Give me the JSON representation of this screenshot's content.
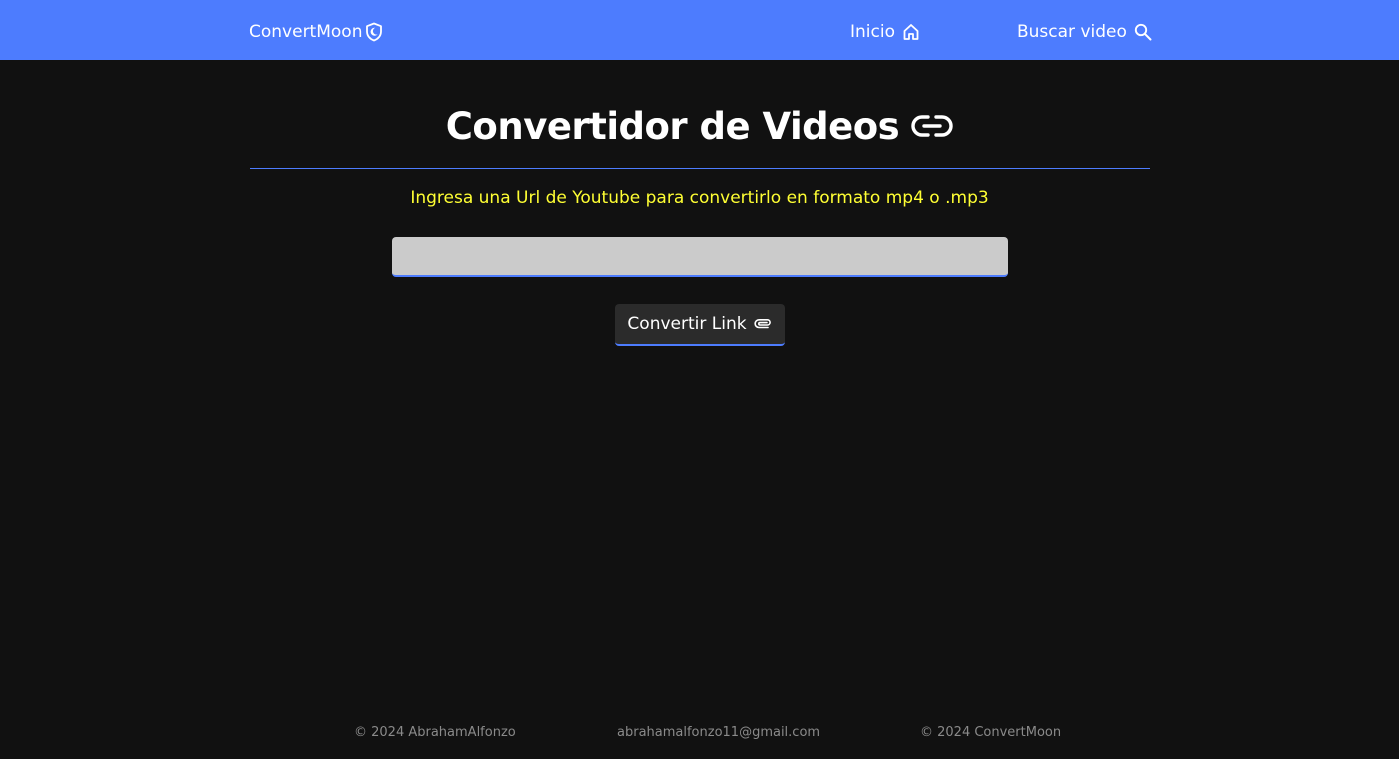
{
  "navbar": {
    "brand": "ConvertMoon",
    "brand_icon": "shield-moon-icon",
    "links": [
      {
        "label": "Inicio",
        "icon": "home-icon"
      },
      {
        "label": "Buscar video",
        "icon": "search-icon"
      }
    ],
    "background": "#4d7cfe"
  },
  "main": {
    "title": "Convertidor de Videos",
    "title_icon": "link-icon",
    "subtitle": "Ingresa una Url de Youtube para convertirlo en formato mp4 o .mp3",
    "url_input": {
      "value": "",
      "placeholder": ""
    },
    "convert_button": {
      "label": "Convertir Link",
      "icon": "paperclip-icon"
    }
  },
  "footer": {
    "items": [
      "© 2024 AbrahamAlfonzo",
      "abrahamalfonzo11@gmail.com",
      "© 2024 ConvertMoon"
    ]
  },
  "colors": {
    "accent": "#4d7cfe",
    "subtitle": "#ffff33",
    "background": "#111111"
  }
}
